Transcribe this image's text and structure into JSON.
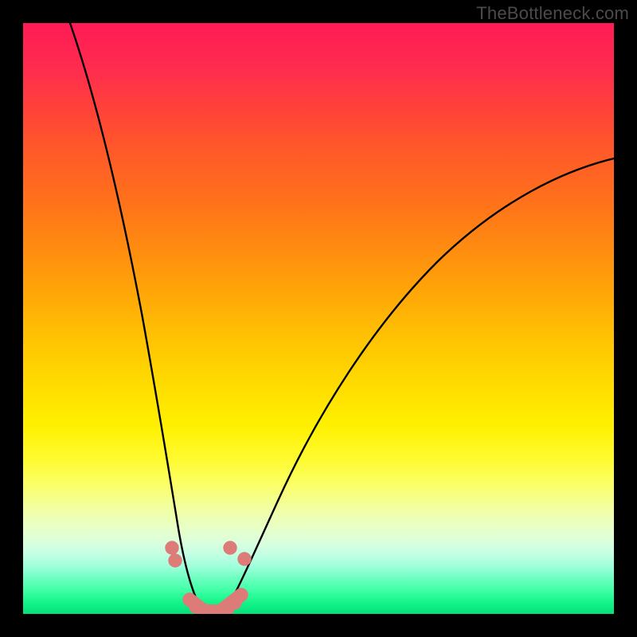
{
  "watermark": "TheBottleneck.com",
  "chart_data": {
    "type": "line",
    "title": "",
    "xlabel": "",
    "ylabel": "",
    "xlim": [
      0,
      100
    ],
    "ylim": [
      0,
      100
    ],
    "grid": false,
    "legend": false,
    "series": [
      {
        "name": "left-branch",
        "x": [
          8,
          10,
          12,
          14,
          16,
          18,
          20,
          21.5,
          23,
          24.3,
          25.3,
          26.2,
          27.1,
          28,
          29,
          30
        ],
        "y": [
          100,
          92,
          83,
          74,
          64,
          53,
          41.5,
          33,
          24,
          16.5,
          11,
          7.3,
          4.3,
          2.2,
          0.9,
          0.3
        ]
      },
      {
        "name": "right-branch",
        "x": [
          34,
          35.5,
          37,
          39,
          42,
          46,
          50,
          55,
          60,
          66,
          73,
          80,
          88,
          95,
          100
        ],
        "y": [
          0.3,
          1.2,
          3.2,
          7.4,
          14.5,
          24.5,
          33,
          42,
          49,
          56,
          62,
          67,
          71.5,
          75,
          77
        ]
      },
      {
        "name": "valley-floor",
        "x": [
          30,
          31,
          32,
          33,
          34
        ],
        "y": [
          0.3,
          0.15,
          0.1,
          0.15,
          0.3
        ]
      }
    ],
    "markers": {
      "name": "highlight-dots",
      "color": "#dd7b78",
      "points": [
        {
          "x": 25.2,
          "y": 11.2
        },
        {
          "x": 25.7,
          "y": 9.0
        },
        {
          "x": 28.2,
          "y": 2.0
        },
        {
          "x": 29.3,
          "y": 0.9
        },
        {
          "x": 30.6,
          "y": 0.3
        },
        {
          "x": 32.0,
          "y": 0.15
        },
        {
          "x": 33.3,
          "y": 0.25
        },
        {
          "x": 34.6,
          "y": 0.8
        },
        {
          "x": 35.9,
          "y": 1.8
        },
        {
          "x": 36.9,
          "y": 3.0
        },
        {
          "x": 35.0,
          "y": 11.2
        },
        {
          "x": 37.5,
          "y": 9.3
        }
      ],
      "segments": [
        {
          "x1": 28.2,
          "y1": 2.0,
          "x2": 30.6,
          "y2": 0.3
        },
        {
          "x1": 30.6,
          "y1": 0.3,
          "x2": 33.3,
          "y2": 0.25
        },
        {
          "x1": 33.3,
          "y1": 0.25,
          "x2": 36.9,
          "y2": 3.0
        }
      ]
    },
    "gradient_stops": [
      {
        "pos": 0.0,
        "color": "#ff1a55"
      },
      {
        "pos": 0.5,
        "color": "#ffd000"
      },
      {
        "pos": 0.82,
        "color": "#f4ff90"
      },
      {
        "pos": 1.0,
        "color": "#04e07a"
      }
    ]
  }
}
